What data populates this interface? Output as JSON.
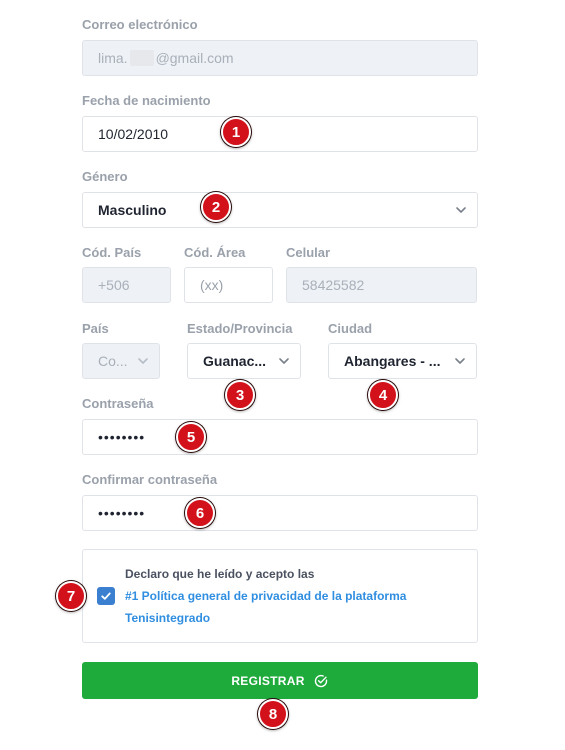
{
  "email": {
    "label": "Correo electrónico",
    "value_start": "lima.",
    "value_end": "@gmail.com"
  },
  "birthdate": {
    "label": "Fecha de nacimiento",
    "value": "10/02/2010"
  },
  "gender": {
    "label": "Género",
    "value": "Masculino"
  },
  "phone": {
    "country_code_label": "Cód. País",
    "country_code_value": "+506",
    "area_code_label": "Cód. Área",
    "area_code_placeholder": "(xx)",
    "mobile_label": "Celular",
    "mobile_value": "58425582"
  },
  "location": {
    "country_label": "País",
    "country_value": "Co...",
    "state_label": "Estado/Provincia",
    "state_value": "Guanac...",
    "city_label": "Ciudad",
    "city_value": "Abangares - ..."
  },
  "password": {
    "label": "Contraseña",
    "value": "••••••••"
  },
  "confirm_password": {
    "label": "Confirmar contraseña",
    "value": "••••••••"
  },
  "terms": {
    "text": "Declaro que he leído y acepto las",
    "link_line1": "#1 Política general de privacidad de la plataforma",
    "link_line2": "Tenisintegrado",
    "checked": true
  },
  "submit": {
    "label": "REGISTRAR"
  },
  "markers": [
    "1",
    "2",
    "3",
    "4",
    "5",
    "6",
    "7",
    "8"
  ],
  "colors": {
    "marker": "#d2111b",
    "submit": "#1eab3c",
    "link": "#2f8ee0",
    "checkbox": "#3b7fd0"
  }
}
